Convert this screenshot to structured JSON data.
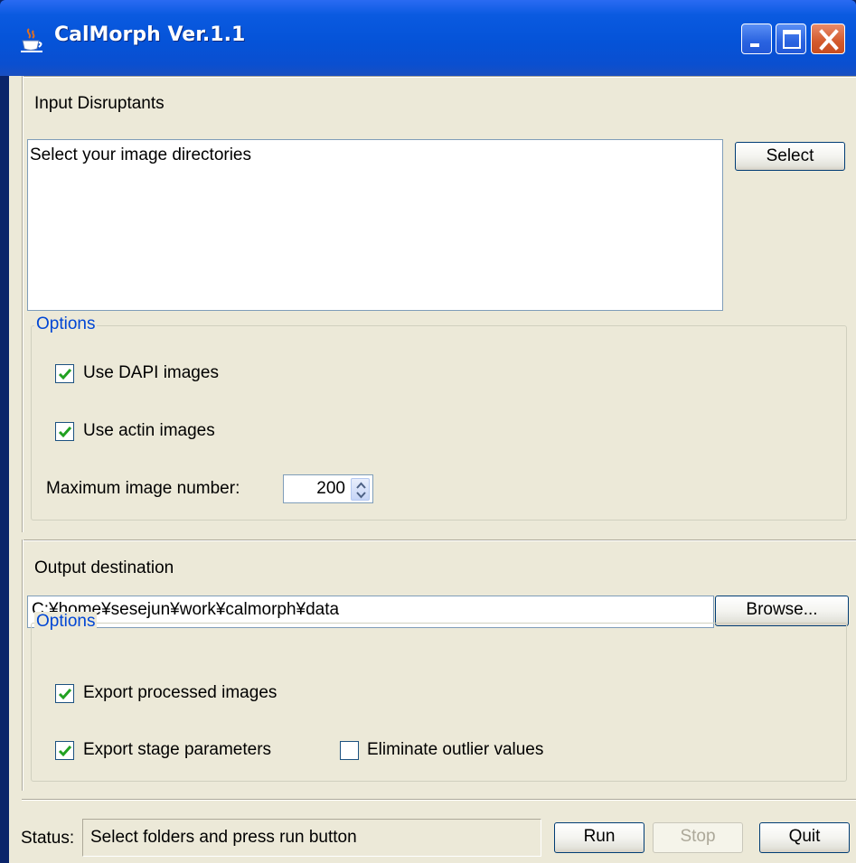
{
  "window": {
    "title": "CalMorph Ver.1.1"
  },
  "input": {
    "section_label": "Input Disruptants",
    "directories_text": "Select your image directories",
    "select_button": "Select",
    "options_title": "Options",
    "use_dapi_label": "Use DAPI images",
    "use_dapi_checked": true,
    "use_actin_label": "Use actin images",
    "use_actin_checked": true,
    "max_image_label": "Maximum image number:",
    "max_image_value": "200"
  },
  "output": {
    "section_label": "Output destination",
    "path_value": "C:¥home¥sesejun¥work¥calmorph¥data",
    "browse_button": "Browse...",
    "options_title": "Options",
    "export_images_label": "Export processed images",
    "export_images_checked": true,
    "export_stage_label": "Export stage parameters",
    "export_stage_checked": true,
    "eliminate_outlier_label": "Eliminate outlier values",
    "eliminate_outlier_checked": false
  },
  "footer": {
    "status_label": "Status:",
    "status_text": "Select folders and press run button",
    "run_button": "Run",
    "stop_button": "Stop",
    "quit_button": "Quit"
  },
  "colors": {
    "titlebar": "#0553d8",
    "group_title": "#0046d5",
    "panel": "#ece9d8",
    "checkmark": "#21a121"
  }
}
